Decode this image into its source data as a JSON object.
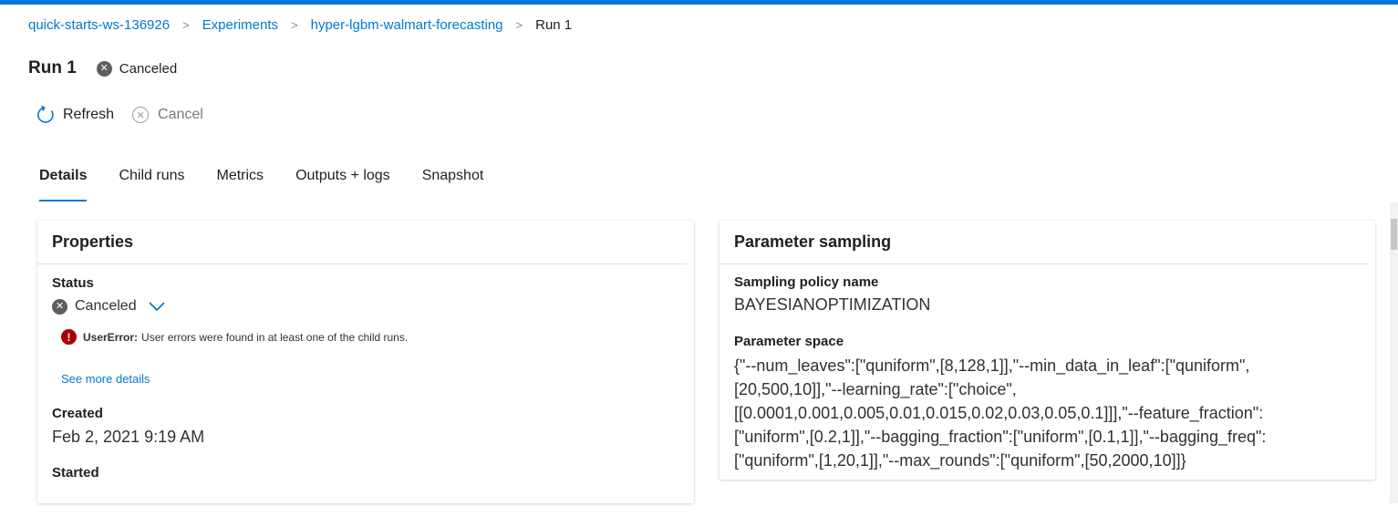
{
  "breadcrumb": {
    "items": [
      "quick-starts-ws-136926",
      "Experiments",
      "hyper-lgbm-walmart-forecasting"
    ],
    "current": "Run 1",
    "separator": ">"
  },
  "page": {
    "title": "Run 1",
    "status": "Canceled"
  },
  "toolbar": {
    "refresh_label": "Refresh",
    "cancel_label": "Cancel"
  },
  "tabs": [
    "Details",
    "Child runs",
    "Metrics",
    "Outputs + logs",
    "Snapshot"
  ],
  "properties": {
    "title": "Properties",
    "status_label": "Status",
    "status_value": "Canceled",
    "error_type": "UserError:",
    "error_message": "User errors were found in at least one of the child runs.",
    "see_more": "See more details",
    "created_label": "Created",
    "created_value": "Feb 2, 2021 9:19 AM",
    "started_label": "Started"
  },
  "parameter_sampling": {
    "title": "Parameter sampling",
    "policy_label": "Sampling policy name",
    "policy_value": "BAYESIANOPTIMIZATION",
    "space_label": "Parameter space",
    "space_lines": [
      "{\"--num_leaves\":[\"quniform\",[8,128,1]],\"--min_data_in_leaf\":[\"quniform\",",
      "[20,500,10]],\"--learning_rate\":[\"choice\",",
      "[[0.0001,0.001,0.005,0.01,0.015,0.02,0.03,0.05,0.1]]],\"--feature_fraction\":",
      "[\"uniform\",[0.2,1]],\"--bagging_fraction\":[\"uniform\",[0.1,1]],\"--bagging_freq\":",
      "[\"quniform\",[1,20,1]],\"--max_rounds\":[\"quniform\",[50,2000,10]]}"
    ]
  },
  "colors": {
    "accent": "#0078d4",
    "error": "#a80000",
    "status_gray": "#605e5c"
  }
}
